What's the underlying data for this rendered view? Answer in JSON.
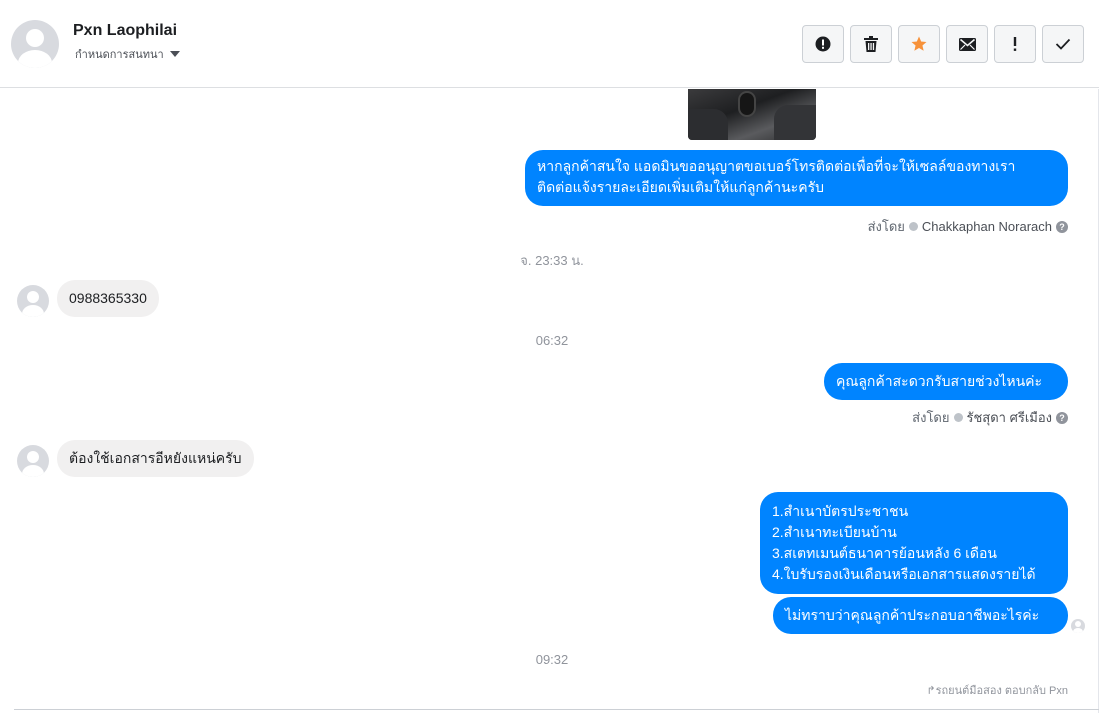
{
  "header": {
    "contact_name": "Pxn Laophilai",
    "assign_label": "กำหนดการสนทนา",
    "actions": [
      {
        "name": "spam",
        "icon": "alert-circle-icon",
        "label": "!"
      },
      {
        "name": "delete",
        "icon": "trash-icon"
      },
      {
        "name": "star",
        "icon": "star-icon",
        "color": "#f7923a"
      },
      {
        "name": "unread",
        "icon": "envelope-icon"
      },
      {
        "name": "follow-up",
        "icon": "exclamation-icon",
        "label": "!"
      },
      {
        "name": "done",
        "icon": "check-icon"
      }
    ]
  },
  "messages": {
    "out1": "หากลูกค้าสนใจ แอดมินขออนุญาตขอเบอร์โทรติดต่อเพื่อที่จะให้เซลล์ของทางเรา\nติดต่อแจ้งรายละเอียดเพิ่มเติมให้แก่ลูกค้านะครับ",
    "out1_sent_by_label": "ส่งโดย",
    "out1_sender": "Chakkaphan Norarach",
    "time1": "จ. 23:33 น.",
    "in1": "0988365330",
    "time2": "06:32",
    "out2": "คุณลูกค้าสะดวกรับสายช่วงไหนค่ะ",
    "out2_sent_by_label": "ส่งโดย",
    "out2_sender": "รัชสุดา ศรีเมือง",
    "in2": "ต้องใช้เอกสารอีหยังแหน่ครับ",
    "out3": "1.สำเนาบัตรประชาชน\n2.สำเนาทะเบียนบ้าน\n3.สเตทเมนต์ธนาคารย้อนหลัง 6 เดือน\n4.ใบรับรองเงินเดือนหรือเอกสารแสดงรายได้",
    "out4": "ไม่ทราบว่าคุณลูกค้าประกอบอาชีพอะไรค่ะ",
    "time3": "09:32",
    "reply_note": "↱รถยนต์มือสอง ตอบกลับ Pxn"
  },
  "colors": {
    "outgoing_bubble": "#0084ff",
    "incoming_bubble": "#f1f0f0",
    "star_active": "#f7923a"
  }
}
